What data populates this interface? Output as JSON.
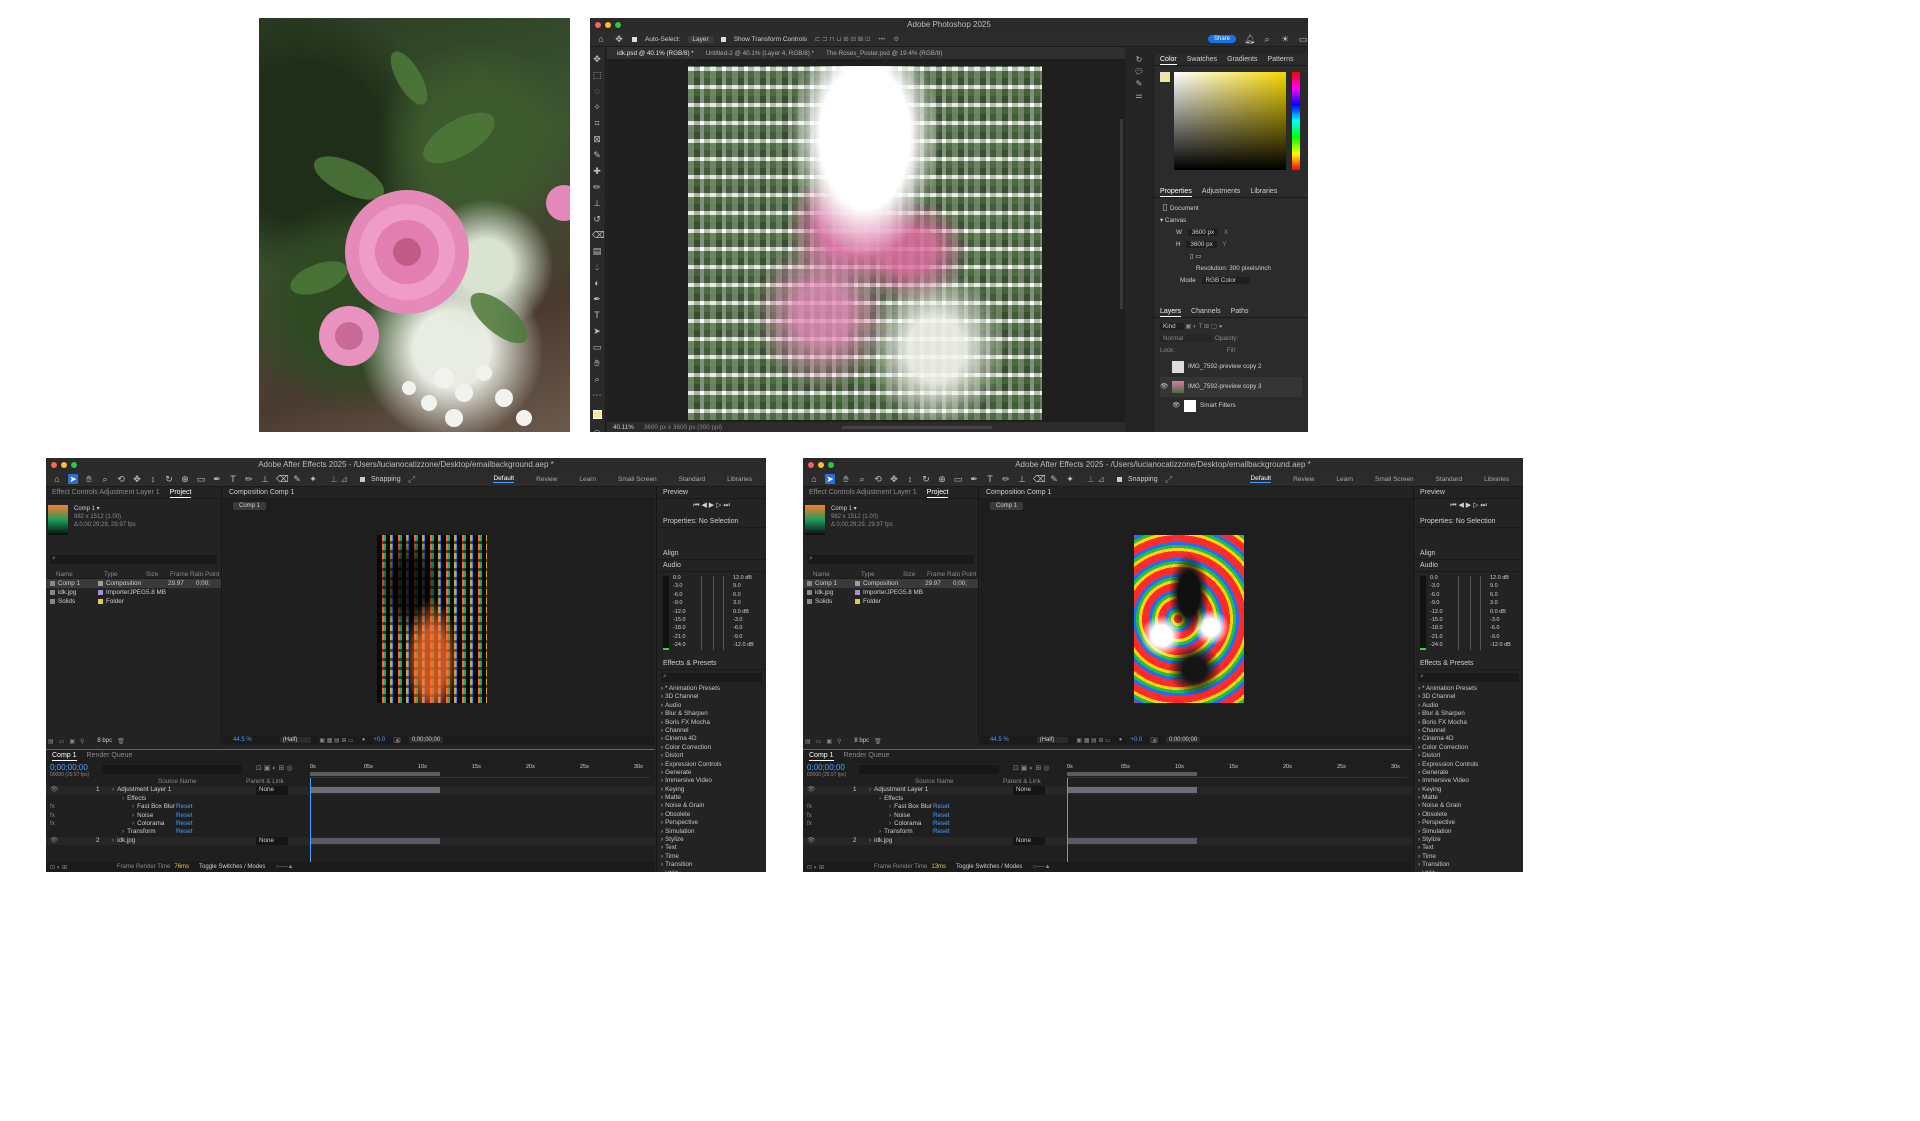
{
  "photo": {
    "alt_subject": "pink-dahlia-photo"
  },
  "photoshop": {
    "title": "Adobe Photoshop 2025",
    "options": {
      "auto_select": "Auto-Select:",
      "layer": "Layer",
      "show_transform": "Show Transform Controls"
    },
    "share": "Share",
    "doc_tabs": [
      "idk.psd @ 40.1% (RGB/8) *",
      "Untitled-2 @ 40.1% (Layer 4, RGB/8) *",
      "The Roses_Poster.psd @ 19.4% (RGB/8)"
    ],
    "status": {
      "zoom": "40.11%",
      "size": "3600 px x 3600 px (300 ppi)"
    },
    "color_tabs": [
      "Color",
      "Swatches",
      "Gradients",
      "Patterns"
    ],
    "prop_tabs": [
      "Properties",
      "Adjustments",
      "Libraries"
    ],
    "properties": {
      "doc_label": "Document",
      "canvas": "Canvas",
      "w_label": "W",
      "w": "3600 px",
      "h_label": "H",
      "h": "3600 px",
      "x_label": "X",
      "y_label": "Y",
      "resolution": "Resolution: 300 pixels/inch",
      "mode_label": "Mode",
      "mode": "RGB Color"
    },
    "layer_tabs": [
      "Layers",
      "Channels",
      "Paths"
    ],
    "layers": {
      "kind": "Kind",
      "blend": "Normal",
      "opacity": "Opacity:",
      "lock": "Lock:",
      "fill": "Fill:",
      "items": [
        "IMG_7592-preview copy 2",
        "IMG_7592-preview copy 3",
        "Smart Filters"
      ]
    }
  },
  "ae_common": {
    "workspaces": [
      "Default",
      "Review",
      "Learn",
      "Small Screen",
      "Standard",
      "Libraries"
    ],
    "snapping": "Snapping",
    "effect_controls": "Effect Controls Adjustment Layer 1",
    "project_tab": "Project",
    "comp_name": "Comp 1",
    "comp_info": [
      "Comp 1 ▾",
      "982 x 1512 (1.00)",
      "Δ 0;00;29;29, 29.97 fps"
    ],
    "project_cols": [
      "Name",
      "Type",
      "Size",
      "Frame Ra...",
      "In Point"
    ],
    "project_rows": [
      {
        "name": "Comp 1",
        "type": "Composition",
        "size": "",
        "fr": "29.97",
        "in": "0;00;",
        "color": "#9d9d9d"
      },
      {
        "name": "idk.jpg",
        "type": "ImporterJPEG",
        "size": "5.8 MB",
        "fr": "",
        "in": "",
        "color": "#a58fd3"
      },
      {
        "name": "Solids",
        "type": "Folder",
        "size": "",
        "fr": "",
        "in": "",
        "color": "#e6c84a"
      }
    ],
    "comp_panel": "Composition Comp 1",
    "comp_tab": "Comp 1",
    "bpc": "8 bpc",
    "viewer_bar": {
      "zoom": "44.5 %",
      "res": "(Half)",
      "plus": "+0.0",
      "time": "0;00;00;00"
    },
    "preview": "Preview",
    "properties": "Properties: No Selection",
    "align": "Align",
    "audio": "Audio",
    "audio_left": [
      "0.0",
      "-3.0",
      "-6.0",
      "-9.0",
      "-12.0",
      "-15.0",
      "-18.0",
      "-21.0",
      "-24.0"
    ],
    "audio_right": [
      "12.0 dB",
      "9.0",
      "6.0",
      "3.0",
      "0.0 dB",
      "-3.0",
      "-6.0",
      "-9.0",
      "-12.0 dB"
    ],
    "effects_presets": "Effects & Presets",
    "effects_list": [
      "* Animation Presets",
      "3D Channel",
      "Audio",
      "Blur & Sharpen",
      "Boris FX Mocha",
      "Channel",
      "Cinema 4D",
      "Color Correction",
      "Distort",
      "Expression Controls",
      "Generate",
      "Immersive Video",
      "Keying",
      "Matte",
      "Noise & Grain",
      "Obsolete",
      "Perspective",
      "Simulation",
      "Stylize",
      "Text",
      "Time",
      "Transition",
      "Utility"
    ],
    "timeline_tab": "Comp 1",
    "render_queue": "Render Queue",
    "timecode": "0;00;00;00",
    "timecode_sub": "00000 (29.97 fps)",
    "ruler": [
      "0s",
      "05s",
      "10s",
      "15s",
      "20s",
      "25s",
      "30s"
    ],
    "tl_cols": [
      "Source Name",
      "Parent & Link"
    ],
    "tl_rows": [
      {
        "num": "1",
        "name": "Adjustment Layer 1",
        "parent": "None",
        "indent": 0,
        "reset": ""
      },
      {
        "num": "",
        "name": "Effects",
        "parent": "",
        "indent": 1,
        "reset": ""
      },
      {
        "num": "",
        "name": "Fast Box Blur",
        "parent": "",
        "indent": 2,
        "reset": "Reset"
      },
      {
        "num": "",
        "name": "Noise",
        "parent": "",
        "indent": 2,
        "reset": "Reset"
      },
      {
        "num": "",
        "name": "Colorama",
        "parent": "",
        "indent": 2,
        "reset": "Reset"
      },
      {
        "num": "",
        "name": "Transform",
        "parent": "",
        "indent": 1,
        "reset": "Reset"
      },
      {
        "num": "2",
        "name": "idk.jpg",
        "parent": "None",
        "indent": 0,
        "reset": ""
      }
    ],
    "frame_render": "Frame Render Time",
    "toggle": "Toggle Switches / Modes"
  },
  "ae_left": {
    "title": "Adobe After Effects 2025 - /Users/lucianocatizzone/Desktop/emailbackground.aep *",
    "render_time": "76ms"
  },
  "ae_right": {
    "title": "Adobe After Effects 2025 - /Users/lucianocatizzone/Desktop/emailbackground.aep *",
    "render_time": "13ms"
  }
}
